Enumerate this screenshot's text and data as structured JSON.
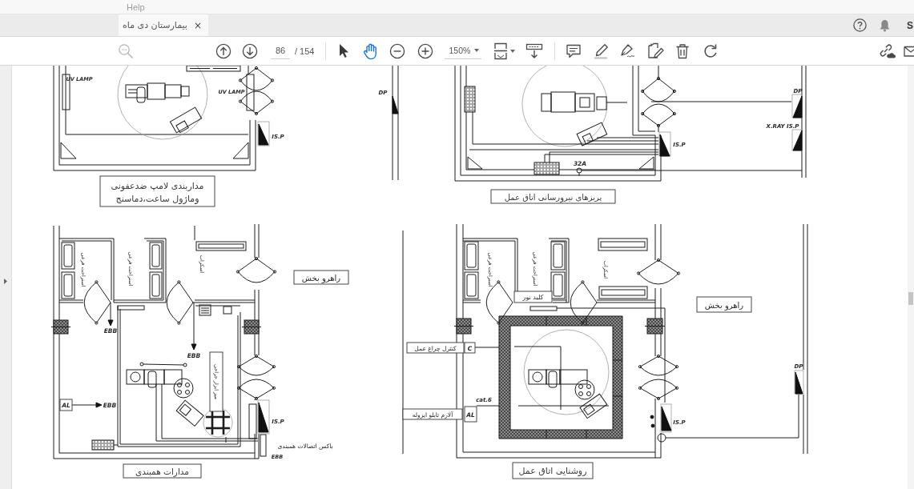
{
  "menu_bar": {
    "items": [
      "Help"
    ]
  },
  "tabs": [
    {
      "label": "بیمارستان دی ماه",
      "close": "×",
      "selected": true
    }
  ],
  "header": {
    "account": "S"
  },
  "toolbar": {
    "page_number": "86",
    "page_total": "/ 154",
    "tools": [
      {
        "selected": false
      },
      {
        "selected": true
      }
    ],
    "zoom": "150%"
  },
  "document": {
    "plans": [
      {
        "caption": [
          "پریزهای نیرورسانی اتاق عمل"
        ],
        "labels": [
          {
            "kind": "text",
            "text": "DP"
          },
          {
            "kind": "text",
            "text": "DP"
          },
          {
            "kind": "text",
            "text": "X.RAY IS.P"
          },
          {
            "kind": "text",
            "text": "IS.P"
          },
          {
            "kind": "text",
            "text": "32A"
          }
        ]
      },
      {
        "caption": [
          "مداربندی لامپ ضدعفونی",
          "وماژول ساعت،دماسنج"
        ],
        "labels": [
          {
            "kind": "text",
            "text": "UV LAMP"
          },
          {
            "kind": "text",
            "text": "UV LAMP"
          },
          {
            "kind": "text",
            "text": "IS.P"
          }
        ]
      },
      {
        "caption": [
          "روشنایی اتاق عمل"
        ],
        "labels": [
          {
            "kind": "vertical",
            "text": "اسکراب"
          },
          {
            "kind": "vertical",
            "text": "استراحت فرعی"
          },
          {
            "kind": "vertical",
            "text": "استراحت فرعی"
          },
          {
            "kind": "boxed",
            "text": "راهرو بخش"
          },
          {
            "kind": "boxed",
            "text": "کلید نور"
          },
          {
            "kind": "boxed",
            "text": "C"
          },
          {
            "kind": "boxed",
            "text": "کنترل چراغ عمل"
          },
          {
            "kind": "text",
            "text": "DP"
          },
          {
            "kind": "text",
            "text": "cat.6"
          },
          {
            "kind": "text",
            "text": "IS.P"
          },
          {
            "kind": "boxed",
            "text": "AL"
          },
          {
            "kind": "boxed",
            "text": "آلارم تابلو ایزوله"
          }
        ]
      },
      {
        "caption": [
          "مدارات همبندی"
        ],
        "labels": [
          {
            "kind": "boxed",
            "text": "راهرو بخش"
          },
          {
            "kind": "vertical",
            "text": "اسکراب"
          },
          {
            "kind": "vertical",
            "text": "استراحت فرعی"
          },
          {
            "kind": "vertical",
            "text": "استراحت فرعی"
          },
          {
            "kind": "text",
            "text": "EBB"
          },
          {
            "kind": "text",
            "text": "EBB"
          },
          {
            "kind": "framed",
            "text": "میز ابزار جراحی"
          },
          {
            "kind": "text",
            "text": "EBB"
          },
          {
            "kind": "boxed",
            "text": "AL"
          },
          {
            "kind": "text",
            "text": "IS.P"
          },
          {
            "kind": "text",
            "text": "باکس اتصالات همبندی"
          },
          {
            "kind": "text",
            "text": "EBB"
          }
        ]
      }
    ]
  }
}
